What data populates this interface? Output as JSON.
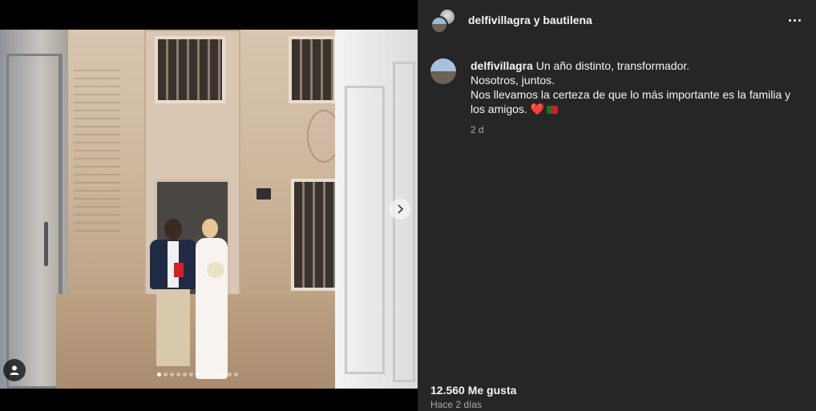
{
  "media": {
    "next_icon": "chevron-right-icon",
    "tag_icon": "user-tag-icon",
    "carousel": {
      "total": 13,
      "active_index": 0
    }
  },
  "post": {
    "header_title": "delfivillagra y bautilena",
    "more_icon": "more-horizontal-icon",
    "caption": {
      "username": "delfivillagra",
      "line1": "Un año distinto, transformador.",
      "line2": "Nosotros, juntos.",
      "line3": "Nos llevamos la certeza de que lo más importante es la familia y los amigos.",
      "emoji_heart": "❤️",
      "emoji_flag": "portugal-flag",
      "time": "2 d"
    },
    "likes": "12.560 Me gusta",
    "posted": "Hace 2 días"
  },
  "colors": {
    "pane_bg": "#262626",
    "text": "#f5f5f5",
    "muted": "#a8a8a8"
  }
}
